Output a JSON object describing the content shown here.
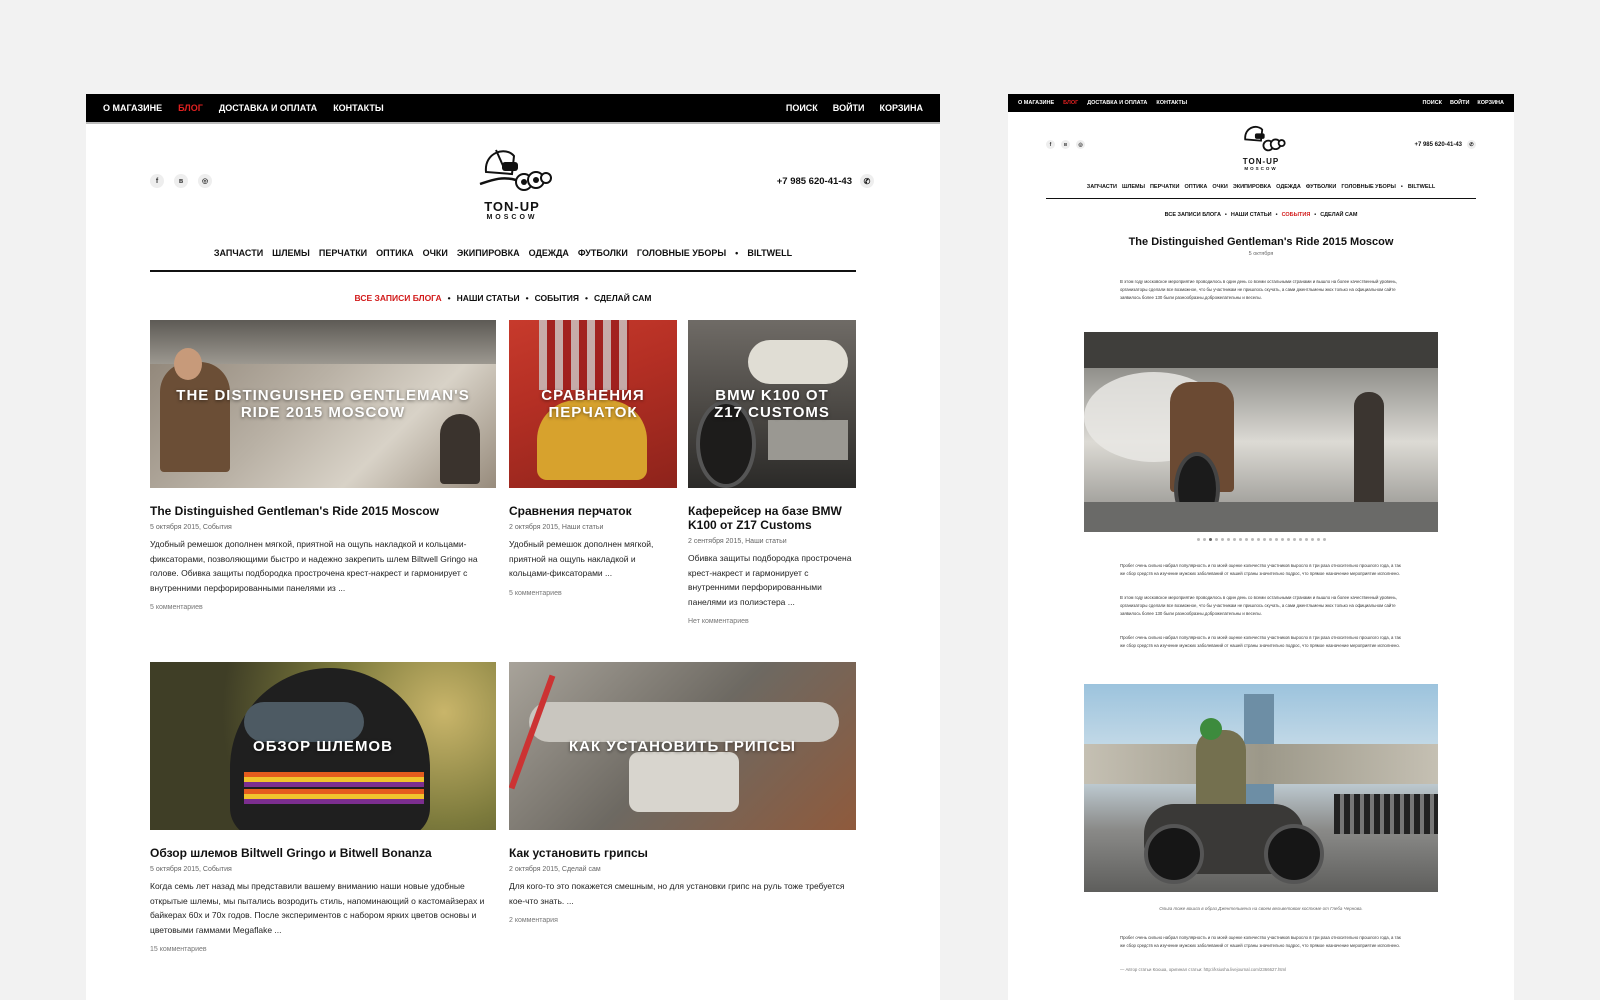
{
  "top_nav": {
    "left": [
      "О магазине",
      "Блог",
      "Доставка и оплата",
      "Контакты"
    ],
    "right": [
      "Поиск",
      "Войти",
      "Корзина"
    ]
  },
  "social": [
    "f",
    "в",
    "◎"
  ],
  "phone": "+7 985 620-41-43",
  "logo": {
    "line1": "TON-UP",
    "line2": "MOSCOW"
  },
  "categories": [
    "Запчасти",
    "Шлемы",
    "Перчатки",
    "Оптика",
    "Очки",
    "Экипировка",
    "Одежда",
    "Футболки",
    "Головные уборы",
    "Biltwell"
  ],
  "blog_tabs": [
    "Все записи блога",
    "Наши статьи",
    "События",
    "Сделай сам"
  ],
  "posts": [
    {
      "overlay": "The Distinguished Gentleman's Ride 2015 Moscow",
      "title": "The Distinguished Gentleman's Ride 2015 Moscow",
      "meta": "5 октября 2015, События",
      "excerpt": "Удобный ремешок дополнен мягкой, приятной на ощупь накладкой и кольцами-фиксаторами, позволяющими быстро и надежно закрепить шлем Biltwell Gringo на голове. Обивка защиты подбородка прострочена крест-накрест и гармонирует с внутренними перфорированными панелями из ...",
      "comments": "5 комментариев"
    },
    {
      "overlay": "Сравнения перчаток",
      "title": "Сравнения перчаток",
      "meta": "2 октября 2015, Наши статьи",
      "excerpt": "Удобный ремешок дополнен мягкой, приятной на ощупь накладкой и кольцами-фиксаторами ...",
      "comments": "5 комментариев"
    },
    {
      "overlay": "BMW K100 от Z17 Customs",
      "title": "Каферейсер на базе BMW K100 от Z17 Customs",
      "meta": "2 сентября 2015, Наши статьи",
      "excerpt": "Обивка защиты подбородка прострочена крест-накрест и гармонирует с внутренними перфорированными панелями из полиэстера ...",
      "comments": "Нет комментариев"
    },
    {
      "overlay": "Обзор шлемов",
      "title": "Обзор шлемов Biltwell Gringo и Bitwell Bonanza",
      "meta": "5 октября 2015, События",
      "excerpt": "Когда семь лет назад мы представили вашему вниманию наши новые удобные открытые шлемы, мы пытались возродить стиль, напоминающий о кастомайзерах и байкерах 60х и 70х годов. После экспериментов с набором ярких цветов основы и цветовыми гаммами Megaflake ...",
      "comments": "15 комментариев"
    },
    {
      "overlay": "Как установить грипсы",
      "title": "Как установить грипсы",
      "meta": "2 октября 2015, Сделай сам",
      "excerpt": "Для кого-то это покажется смешным, но для установки грипс на руль тоже требуется кое-что знать. ...",
      "comments": "2 комментария"
    }
  ],
  "article": {
    "title": "The Distinguished Gentleman's Ride 2015 Moscow",
    "date": "5 октября",
    "intro": "В этом году московское мероприятие проводилось в один день со всеми остальными странами и вышло на более качественный уровень, организаторы сделали все возможное, что бы участникам не пришлось скучать, а сами джентльмены жюх только на официальном сайте заявилось более 130 были разнообразны,доброжелательны и веселы.",
    "p1": "Пробег очень сильно набрал популярность и по моей оценке количество участников выросло в три раза относительно прошлого года, а так же сбор средств на изучение мужских заболеваний от нашей страны значительно подрос, что прямое назначение мероприятие исполнено.",
    "p2": "В этом году московское мероприятие проводилось в один день со всеми остальными странами и вышло на более качественный уровень, организаторы сделали все возможное, что бы участникам не пришлось скучать, а сами джентльмены жюх только на официальном сайте заявилось более 130 были разнообразны,доброжелательны и веселы.",
    "p3": "Пробег очень сильно набрал популярность и по моей оценке количество участников выросло в три раза относительно прошлого года, а так же сбор средств на изучение мужских заболеваний от нашей страны значительно подрос, что прямое назначение мероприятие исполнено.",
    "caption": "Ольга тоже вошла в образ Джентельмена на своем вельветовом костюме от Глеба Чернова.",
    "p4": "Пробег очень сильно набрал популярность и по моей оценке количество участников выросло в три раза относительно прошлого года, а так же сбор средств на изучение мужских заболеваний от нашей страны значительно подрос, что прямое назначение мероприятие исполнено.",
    "footnote": "— Автор статьи Ксюша, оригинал статьи: http://ksiusha.livejournal.com/2366627.html",
    "pager_count": 22,
    "pager_active": 2
  }
}
